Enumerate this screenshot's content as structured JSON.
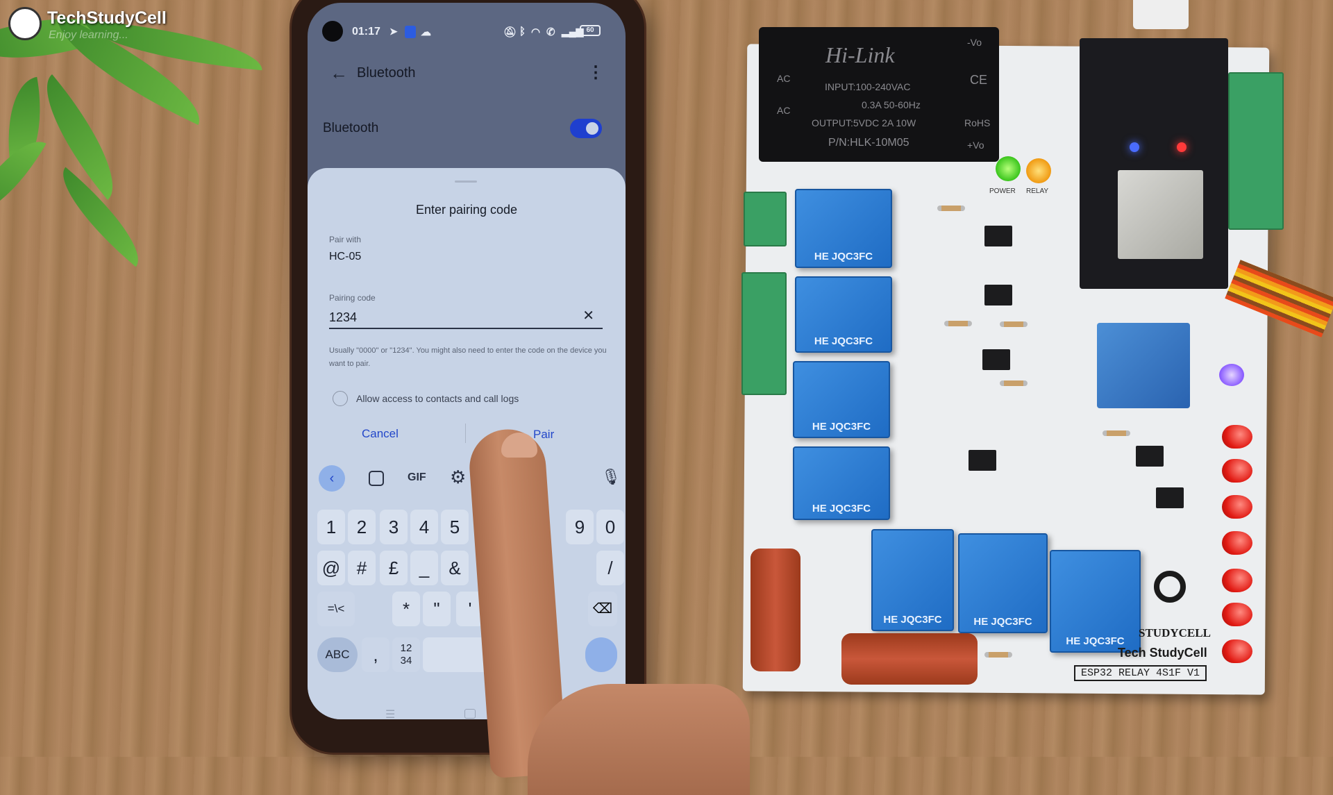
{
  "watermark": {
    "brand": "TechStudyCell",
    "tagline": "Enjoy learning..."
  },
  "phone": {
    "status": {
      "time": "01:17",
      "battery": "60"
    },
    "header": {
      "title": "Bluetooth",
      "back_icon": "arrow-left-icon",
      "menu_icon": "more-vertical-icon"
    },
    "bluetooth_row": {
      "label": "Bluetooth",
      "toggle_on": true,
      "accent": "#1f3fcf"
    },
    "dialog": {
      "title": "Enter pairing code",
      "pair_with_label": "Pair with",
      "device": "HC-05",
      "code_label": "Pairing code",
      "code_value": "1234",
      "helper": "Usually \"0000\" or \"1234\". You might also need to enter the code on the device you want to pair.",
      "checkbox_label": "Allow access to contacts and call logs",
      "checkbox_checked": false,
      "cancel": "Cancel",
      "pair": "Pair"
    },
    "keyboard": {
      "toolbar": {
        "gif": "GIF"
      },
      "row1": [
        "1",
        "2",
        "3",
        "4",
        "5",
        "9",
        "0"
      ],
      "row2": [
        "@",
        "#",
        "£",
        "_",
        "&",
        "/"
      ],
      "row3": [
        "=\\<",
        "*",
        "\"",
        "'",
        ":"
      ],
      "abc": "ABC",
      "comma": ",",
      "numpad": "12\n34"
    }
  },
  "board": {
    "psu": {
      "brand": "Hi-Link",
      "input": "INPUT:100-240VAC",
      "current": "0.3A 50-60Hz",
      "output": "OUTPUT:5VDC 2A 10W",
      "part": "P/N:HLK-10M05",
      "ac": "AC",
      "vo": "-Vo",
      "vo2": "+Vo",
      "rohs": "RoHS",
      "ce": "CE"
    },
    "led_labels": {
      "power": "POWER",
      "relay": "RELAY"
    },
    "relay_label": "HE JQC3FC",
    "logo_text": "STUDYCELL",
    "brand": "Tech StudyCell",
    "version": "ESP32 RELAY 4S1F V1"
  }
}
